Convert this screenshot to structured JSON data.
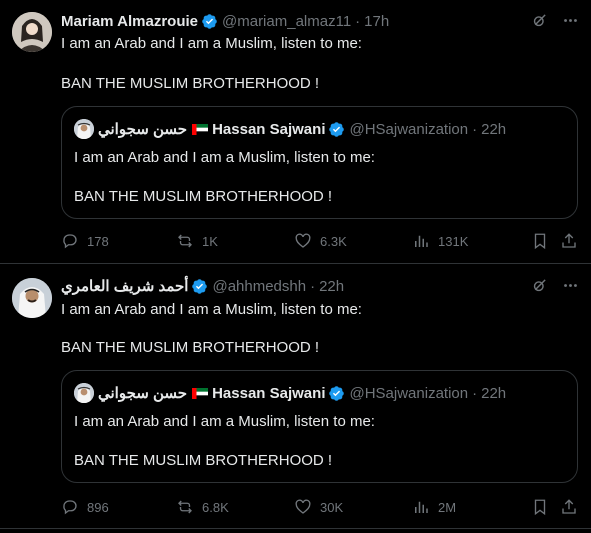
{
  "tweets": [
    {
      "author_name": "Mariam Almazrouie",
      "handle": "@mariam_almaz11",
      "separator": "·",
      "time": "17h",
      "text_line1": "I am an Arab and I am a Muslim, listen to me:",
      "text_line2": "BAN THE MUSLIM BROTHERHOOD !",
      "quote": {
        "name_arabic": "حسن سجواني",
        "name": "Hassan Sajwani",
        "handle": "@HSajwanization",
        "separator": "·",
        "time": "22h",
        "text_line1": "I am an Arab and I am a Muslim, listen to me:",
        "text_line2": "BAN THE MUSLIM BROTHERHOOD !"
      },
      "stats": {
        "replies": "178",
        "reposts": "1K",
        "likes": "6.3K",
        "views": "131K"
      }
    },
    {
      "author_name": "أحمد شريف العامري",
      "handle": "@ahhmedshh",
      "separator": "·",
      "time": "22h",
      "text_line1": "I am an Arab and I am a Muslim, listen to me:",
      "text_line2": "BAN THE MUSLIM BROTHERHOOD !",
      "quote": {
        "name_arabic": "حسن سجواني",
        "name": "Hassan Sajwani",
        "handle": "@HSajwanization",
        "separator": "·",
        "time": "22h",
        "text_line1": "I am an Arab and I am a Muslim, listen to me:",
        "text_line2": "BAN THE MUSLIM BROTHERHOOD !"
      },
      "stats": {
        "replies": "896",
        "reposts": "6.8K",
        "likes": "30K",
        "views": "2M"
      }
    }
  ],
  "icons": {
    "verified": "verified-badge-icon",
    "grok": "grok-icon",
    "more": "more-icon",
    "reply": "reply-icon",
    "repost": "repost-icon",
    "like": "heart-icon",
    "views": "views-icon",
    "bookmark": "bookmark-icon",
    "share": "share-icon",
    "flag": "uae-flag-icon"
  },
  "colors": {
    "background": "#000000",
    "text": "#e7e9ea",
    "muted": "#71767b",
    "border": "#2f3336",
    "verified": "#1d9bf0"
  }
}
